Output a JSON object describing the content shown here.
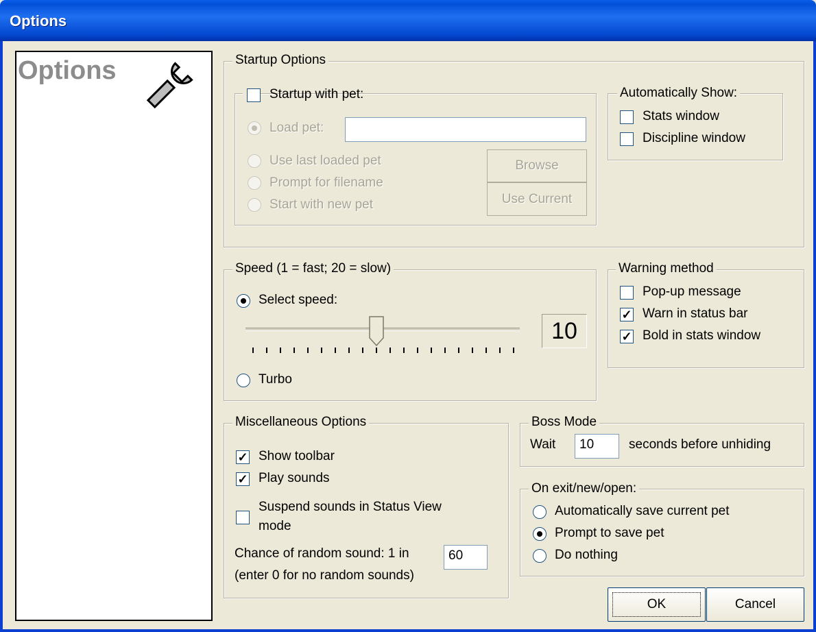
{
  "window": {
    "title": "Options"
  },
  "side_panel": {
    "title": "Options",
    "icon": "wrench-icon"
  },
  "startup": {
    "group_label": "Startup Options",
    "startup_with_pet": {
      "label": "Startup with pet:",
      "checked": false
    },
    "load_pet": {
      "label": "Load pet:",
      "value": ""
    },
    "use_last": "Use last loaded pet",
    "prompt_filename": "Prompt for filename",
    "start_new": "Start with new pet",
    "browse_button": "Browse",
    "use_current_button": "Use Current"
  },
  "auto_show": {
    "group_label": "Automatically Show:",
    "stats_window": {
      "label": "Stats window",
      "checked": false
    },
    "discipline_window": {
      "label": "Discipline window",
      "checked": false
    }
  },
  "speed": {
    "group_label": "Speed (1 = fast; 20 = slow)",
    "select_speed": "Select speed:",
    "value": "10",
    "min": 1,
    "max": 20,
    "turbo": "Turbo",
    "selected": "select_speed"
  },
  "warning": {
    "group_label": "Warning method",
    "popup": {
      "label": "Pop-up message",
      "checked": false
    },
    "status_bar": {
      "label": "Warn in status bar",
      "checked": true
    },
    "bold_stats": {
      "label": "Bold in stats window",
      "checked": true
    }
  },
  "misc": {
    "group_label": "Miscellaneous Options",
    "show_toolbar": {
      "label": "Show toolbar",
      "checked": true
    },
    "play_sounds": {
      "label": "Play sounds",
      "checked": true
    },
    "suspend_line1": "Suspend sounds in Status View",
    "suspend_line2": "mode",
    "chance_label": "Chance of random sound:  1 in",
    "chance_value": "60",
    "chance_hint": "(enter 0 for no random sounds)"
  },
  "boss": {
    "group_label": "Boss Mode",
    "wait_label": "Wait",
    "wait_value": "10",
    "suffix": "seconds before unhiding"
  },
  "on_exit": {
    "group_label": "On exit/new/open:",
    "auto_save": "Automatically save current pet",
    "prompt_save": "Prompt to save pet",
    "do_nothing": "Do nothing",
    "selected": "prompt_save"
  },
  "buttons": {
    "ok": "OK",
    "cancel": "Cancel"
  }
}
